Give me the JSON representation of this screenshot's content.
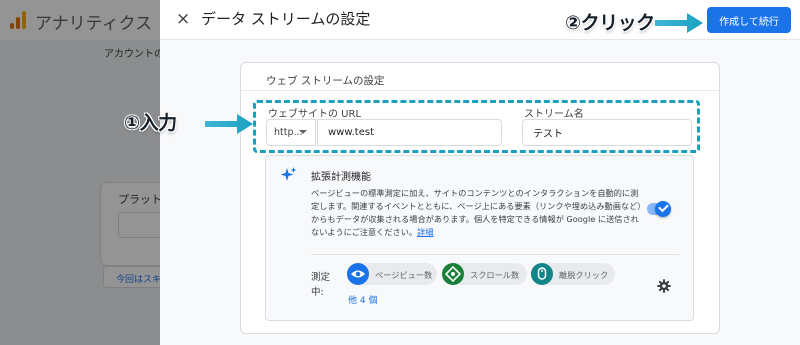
{
  "background": {
    "app_title": "アナリティクス",
    "breadcrumb": "アカウントの作",
    "card_label": "プラット",
    "skip_button": "今回はスキ"
  },
  "panel": {
    "title": "データ ストリームの設定",
    "close_icon": "×",
    "create_button": "作成して続行"
  },
  "stream": {
    "heading": "ウェブ ストリームの設定",
    "url_label": "ウェブサイトの URL",
    "protocol_value": "http...",
    "url_value": "www.test",
    "name_label": "ストリーム名",
    "name_value": "テスト"
  },
  "enhanced": {
    "title": "拡張計測機能",
    "description": "ページビューの標準測定に加え、サイトのコンテンツとのインタラクションを自動的に測定します。関連するイベントとともに、ページ上にある要素（リンクや埋め込み動画など）からもデータが収集される場合があります。個人を特定できる情報が Google に送信されないようにご注意ください。",
    "learn_more": "詳細",
    "toggle_on": true,
    "measuring_label": "測定中:",
    "chips": [
      {
        "label": "ページビュー数",
        "icon": "eye-icon",
        "color": "#1a73e8"
      },
      {
        "label": "スクロール数",
        "icon": "scroll-target-icon",
        "color": "#188038"
      },
      {
        "label": "離脱クリック",
        "icon": "mouse-icon",
        "color": "#12858a"
      }
    ],
    "more_link": "他 4 個"
  },
  "annotations": {
    "step1": "①入力",
    "step2": "②クリック",
    "highlight_color": "#1ca0c0"
  }
}
